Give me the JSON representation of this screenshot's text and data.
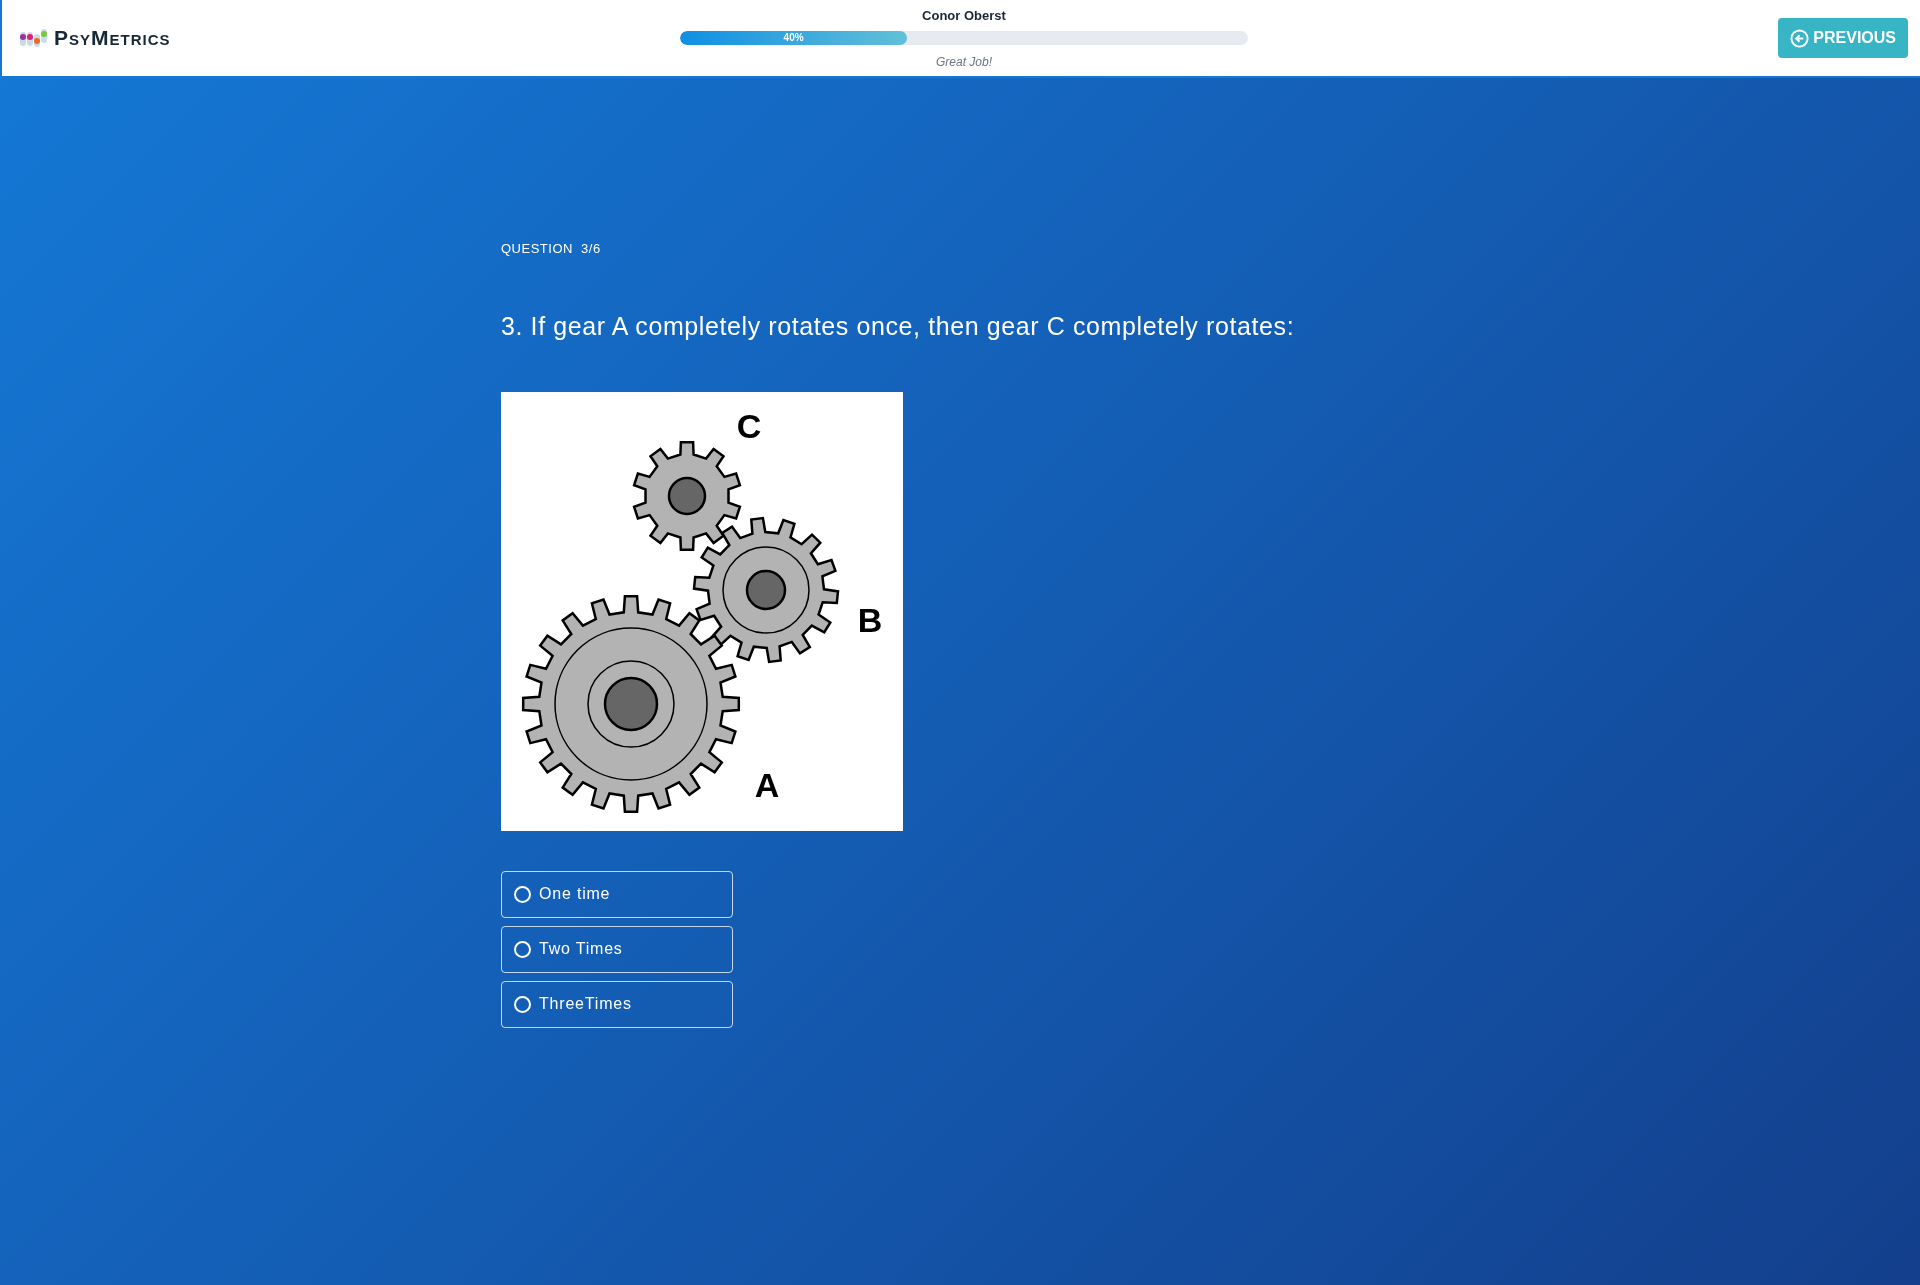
{
  "header": {
    "logo": "PsyMetrics",
    "candidate": "Conor Oberst",
    "progress": {
      "level": 0.4,
      "label": "40%"
    },
    "message": "Great Job!",
    "previous_button": "PREVIOUS"
  },
  "question": {
    "counter": "QUESTION  3/6",
    "text": "3. If gear A completely rotates once, then gear C completely rotates:",
    "figure": {
      "labels": [
        {
          "kind": "C",
          "text": "C"
        },
        {
          "kind": "B",
          "text": "B"
        },
        {
          "kind": "A",
          "text": "A"
        }
      ]
    },
    "options": [
      {
        "label": "One time",
        "selected": false
      },
      {
        "label": "Two Times",
        "selected": false
      },
      {
        "label": "ThreeTimes",
        "selected": false
      }
    ]
  }
}
